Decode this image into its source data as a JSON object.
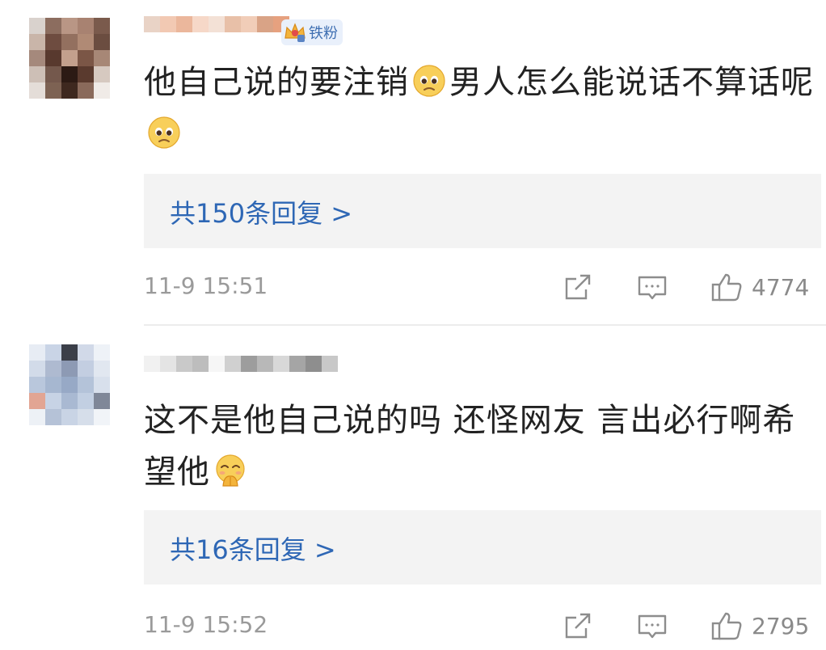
{
  "comments": [
    {
      "badge": "铁粉",
      "text_parts": [
        "他自己说的要注销",
        "男人怎么能说话不算话呢"
      ],
      "replies_label": "共150条回复 >",
      "timestamp": "11-9 15:51",
      "like_count": "4774",
      "emoji_1": "pleading-face",
      "emoji_2": "pleading-face"
    },
    {
      "text": "这不是他自己说的吗 还怪网友 言出必行啊希望他",
      "replies_label": "共16条回复 >",
      "timestamp": "11-9 15:52",
      "like_count": "2795",
      "emoji": "hugging-face"
    }
  ],
  "icons": {
    "share": "share-icon",
    "comment": "comment-icon",
    "like": "thumbs-up-icon",
    "crown": "fan-crown-icon"
  },
  "colors": {
    "link_blue": "#2e67b5",
    "meta_gray": "#9a9a9a",
    "reply_bg": "#f3f3f3"
  }
}
